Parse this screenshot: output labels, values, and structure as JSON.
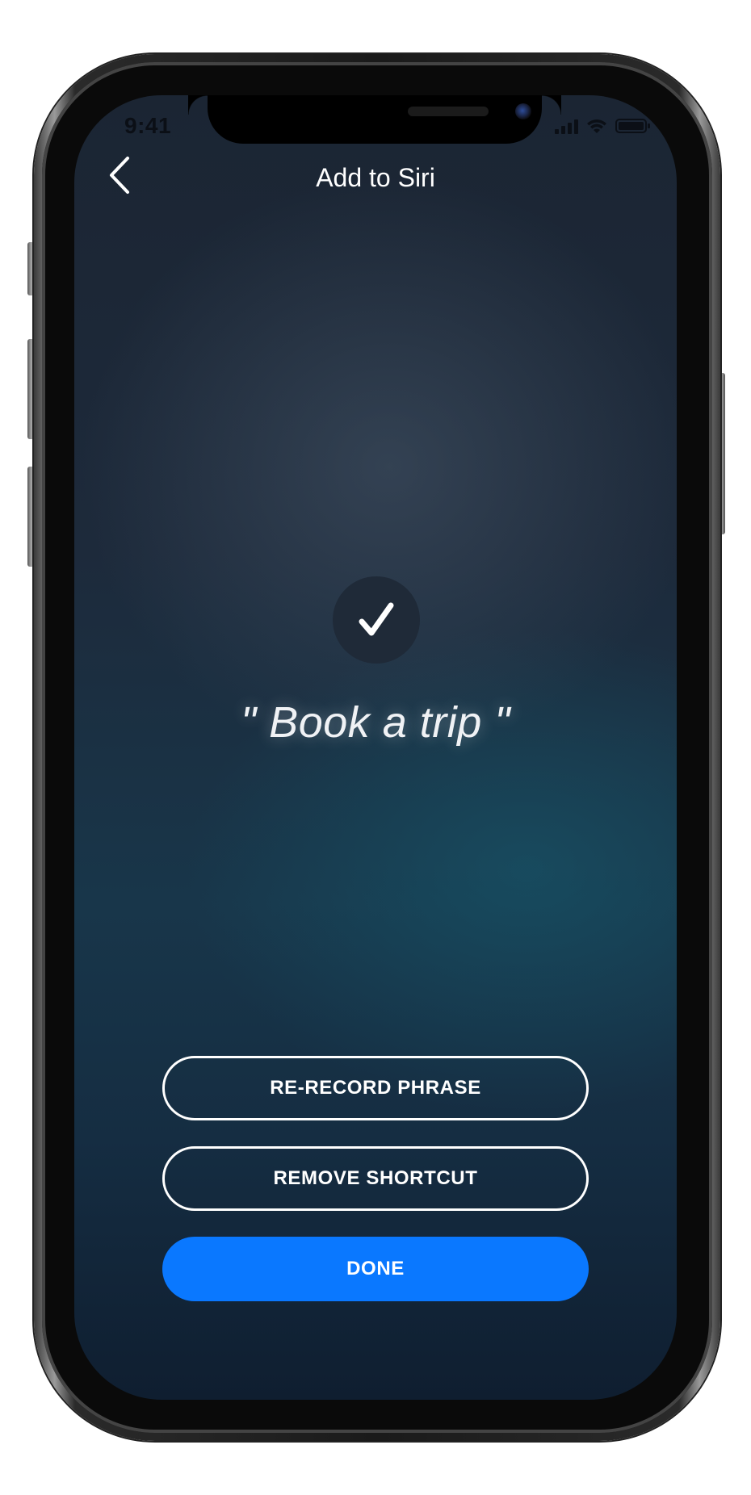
{
  "status_bar": {
    "time": "9:41"
  },
  "nav": {
    "title": "Add to Siri",
    "back_icon": "chevron-left-icon"
  },
  "confirmation": {
    "icon": "checkmark-icon",
    "phrase": "\" Book a trip \""
  },
  "actions": {
    "rerecord_label": "RE-RECORD PHRASE",
    "remove_label": "REMOVE SHORTCUT",
    "done_label": "DONE"
  },
  "colors": {
    "done_button": "#0a78ff",
    "text": "#ffffff"
  }
}
